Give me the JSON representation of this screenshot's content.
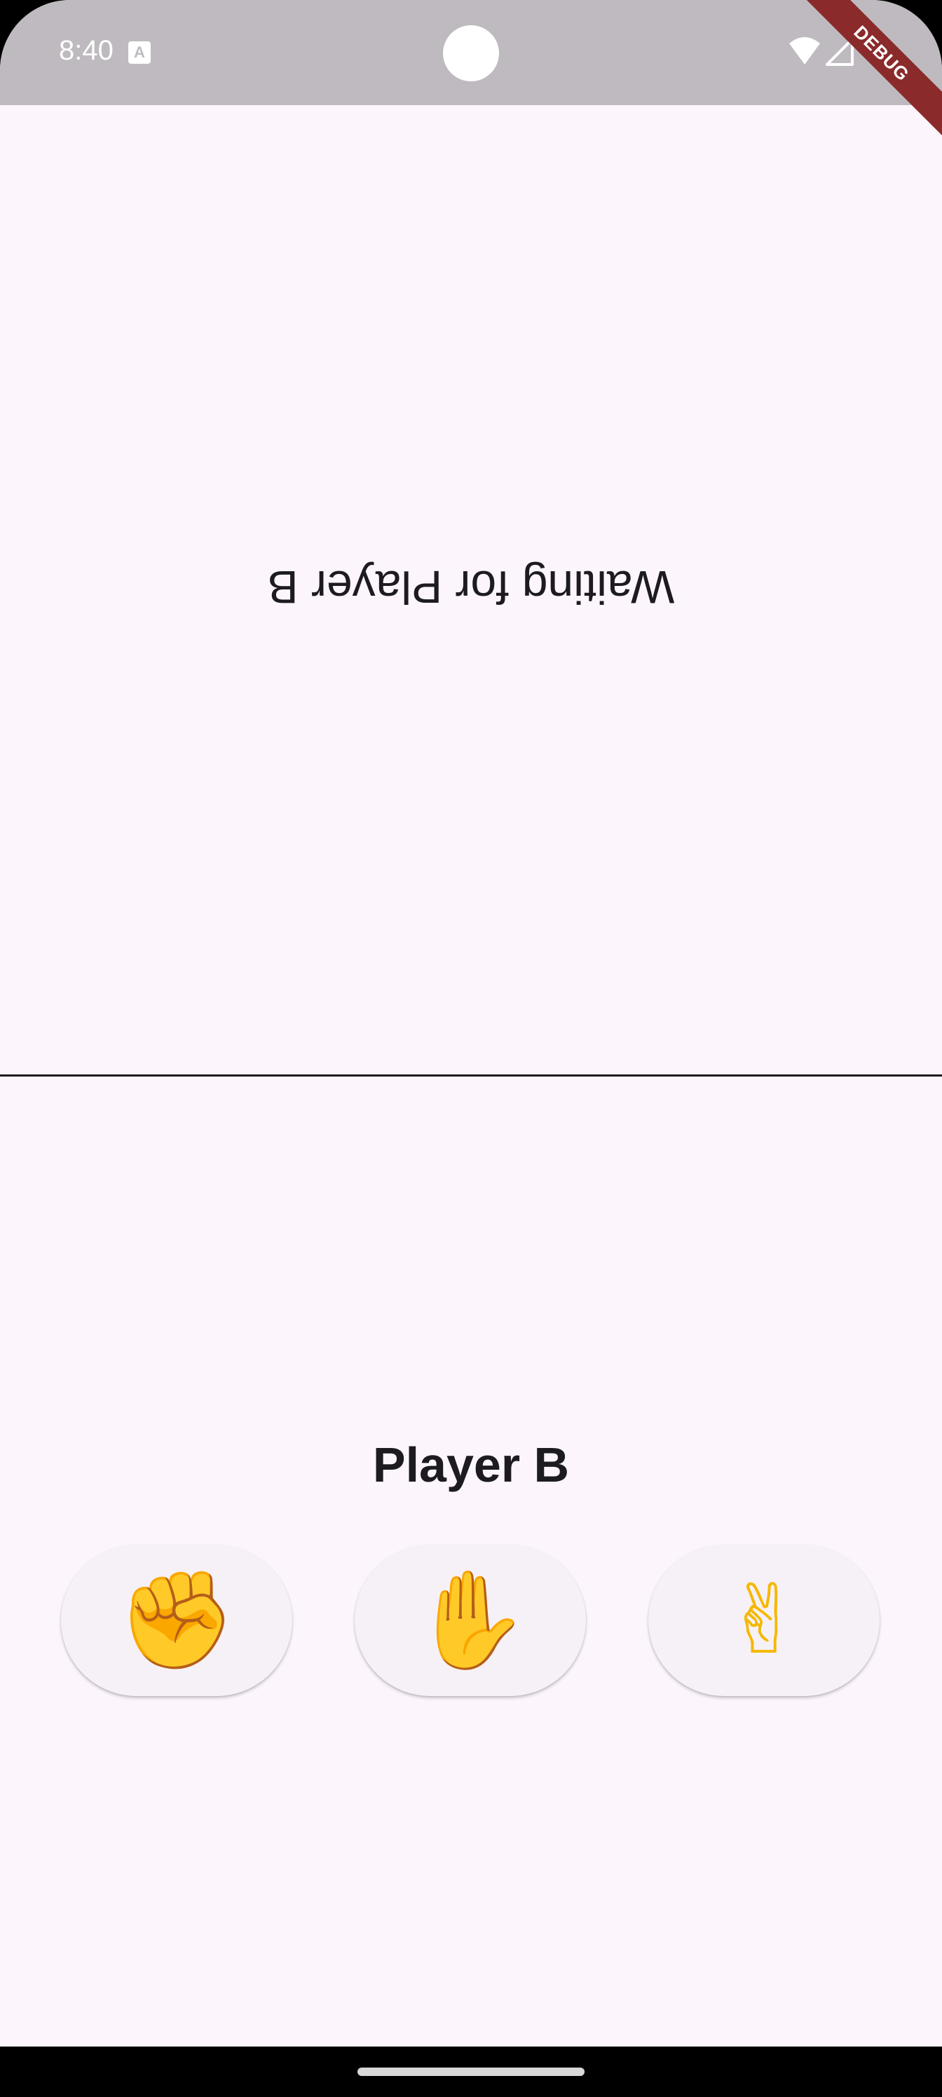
{
  "status_bar": {
    "time": "8:40",
    "notification_icon": "A",
    "icons": [
      "wifi-icon",
      "signal-icon"
    ]
  },
  "debug_banner": {
    "label": "DEBUG"
  },
  "top_half": {
    "waiting_text": "Waiting for Player B"
  },
  "bottom_half": {
    "player_label": "Player B",
    "choices": [
      {
        "name": "rock",
        "emoji": "✊",
        "icon": "raised-fist-icon"
      },
      {
        "name": "paper",
        "emoji": "✋",
        "icon": "raised-hand-icon"
      },
      {
        "name": "scissors",
        "emoji": "✌",
        "icon": "victory-hand-icon"
      }
    ]
  },
  "colors": {
    "background": "#fcf6fc",
    "status_bar": "#bebabf",
    "button": "#f6f1f7",
    "text": "#1d1b20",
    "debug": "#8a2a2b"
  }
}
